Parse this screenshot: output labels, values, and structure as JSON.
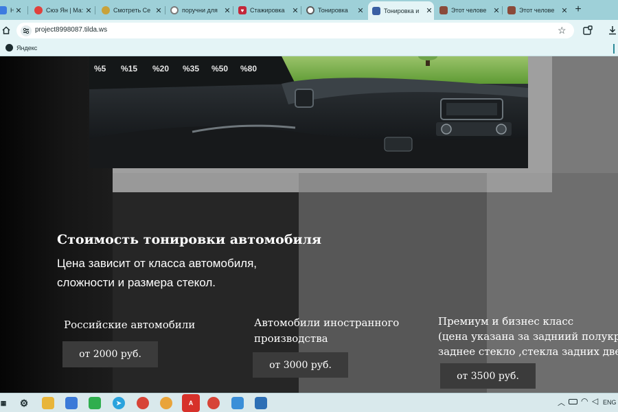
{
  "browser": {
    "tabs": [
      {
        "title": "Неуд",
        "icon": "document-icon",
        "color": "#3d7be0"
      },
      {
        "title": "Сюэ Ян | Ма:",
        "icon": "flame-icon",
        "color": "#e0413d"
      },
      {
        "title": "Смотреть Се",
        "icon": "flower-icon",
        "color": "#c9a23a"
      },
      {
        "title": "поручни для",
        "icon": "circle-icon",
        "color": "#7a7a7a"
      },
      {
        "title": "Стажировка",
        "icon": "heart-icon",
        "color": "#c2273a"
      },
      {
        "title": "Тонировка",
        "icon": "circle-icon",
        "color": "#5a5a5a"
      },
      {
        "title": "Тонировка и",
        "icon": "car-icon",
        "color": "#3a5fa3"
      },
      {
        "title": "Этот челове",
        "icon": "portrait-icon",
        "color": "#8a4a3a"
      },
      {
        "title": "Этот челове",
        "icon": "portrait-icon",
        "color": "#8a4a3a"
      }
    ],
    "new_tab": "+",
    "url": "project8998087.tilda.ws",
    "bookmark": "Яндекс"
  },
  "hero": {
    "tint_levels": [
      "%5",
      "%15",
      "%20",
      "%35",
      "%50",
      "%80"
    ]
  },
  "pricing": {
    "title": "Стоимость тонировки автомобиля",
    "subtitle_line1": "Цена зависит от класса автомобиля,",
    "subtitle_line2": "сложности и размера стекол.",
    "categories": [
      {
        "lines": [
          "Российские автомобили"
        ],
        "price": "от 2000 руб."
      },
      {
        "lines": [
          "Автомобили иностранного",
          "производства"
        ],
        "price": "от 3000 руб."
      },
      {
        "lines": [
          "Премиум и бизнес класс",
          "(цена указана за задниий полукруг-",
          "заднее стекло ,стекла задних дверей)"
        ],
        "price": "от 3500 руб."
      }
    ]
  },
  "taskbar": {
    "lang": "ENG"
  }
}
